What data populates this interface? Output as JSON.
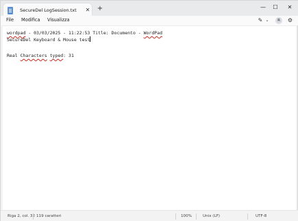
{
  "tab": {
    "title": "SecureDel LogSession.txt",
    "close_glyph": "✕",
    "add_glyph": "+",
    "icon": "notepad-document-icon"
  },
  "window_controls": {
    "minimize": "—",
    "maximize": "☐",
    "close": "✕"
  },
  "menu": {
    "file": "File",
    "edit": "Modifica",
    "view": "Visualizza"
  },
  "toolbar": {
    "copilot_glyph": "✎",
    "chevron_glyph": "⌄",
    "avatar_letter": "R",
    "settings_glyph": "⚙"
  },
  "editor": {
    "line1": {
      "word_misspelled_1": "wordpad",
      "middle": " - 03/03/2025 - 11:22:53 Title: Documento - ",
      "word_misspelled_2": "WordPad"
    },
    "line2": "SecureDel Keyboard & Mouse test",
    "line3": {
      "prefix": "Real ",
      "word_misspelled_1": "Characters",
      "space": " ",
      "word_misspelled_2": "typed",
      "suffix": ": 31"
    }
  },
  "status": {
    "position": "Riga 2, col. 32",
    "chars": "119 caratteri",
    "zoom": "100%",
    "line_ending": "Unix (LF)",
    "encoding": "UTF-8"
  },
  "colors": {
    "spell_underline": "#c42b1c",
    "tab_icon": "#5b8fd6"
  }
}
